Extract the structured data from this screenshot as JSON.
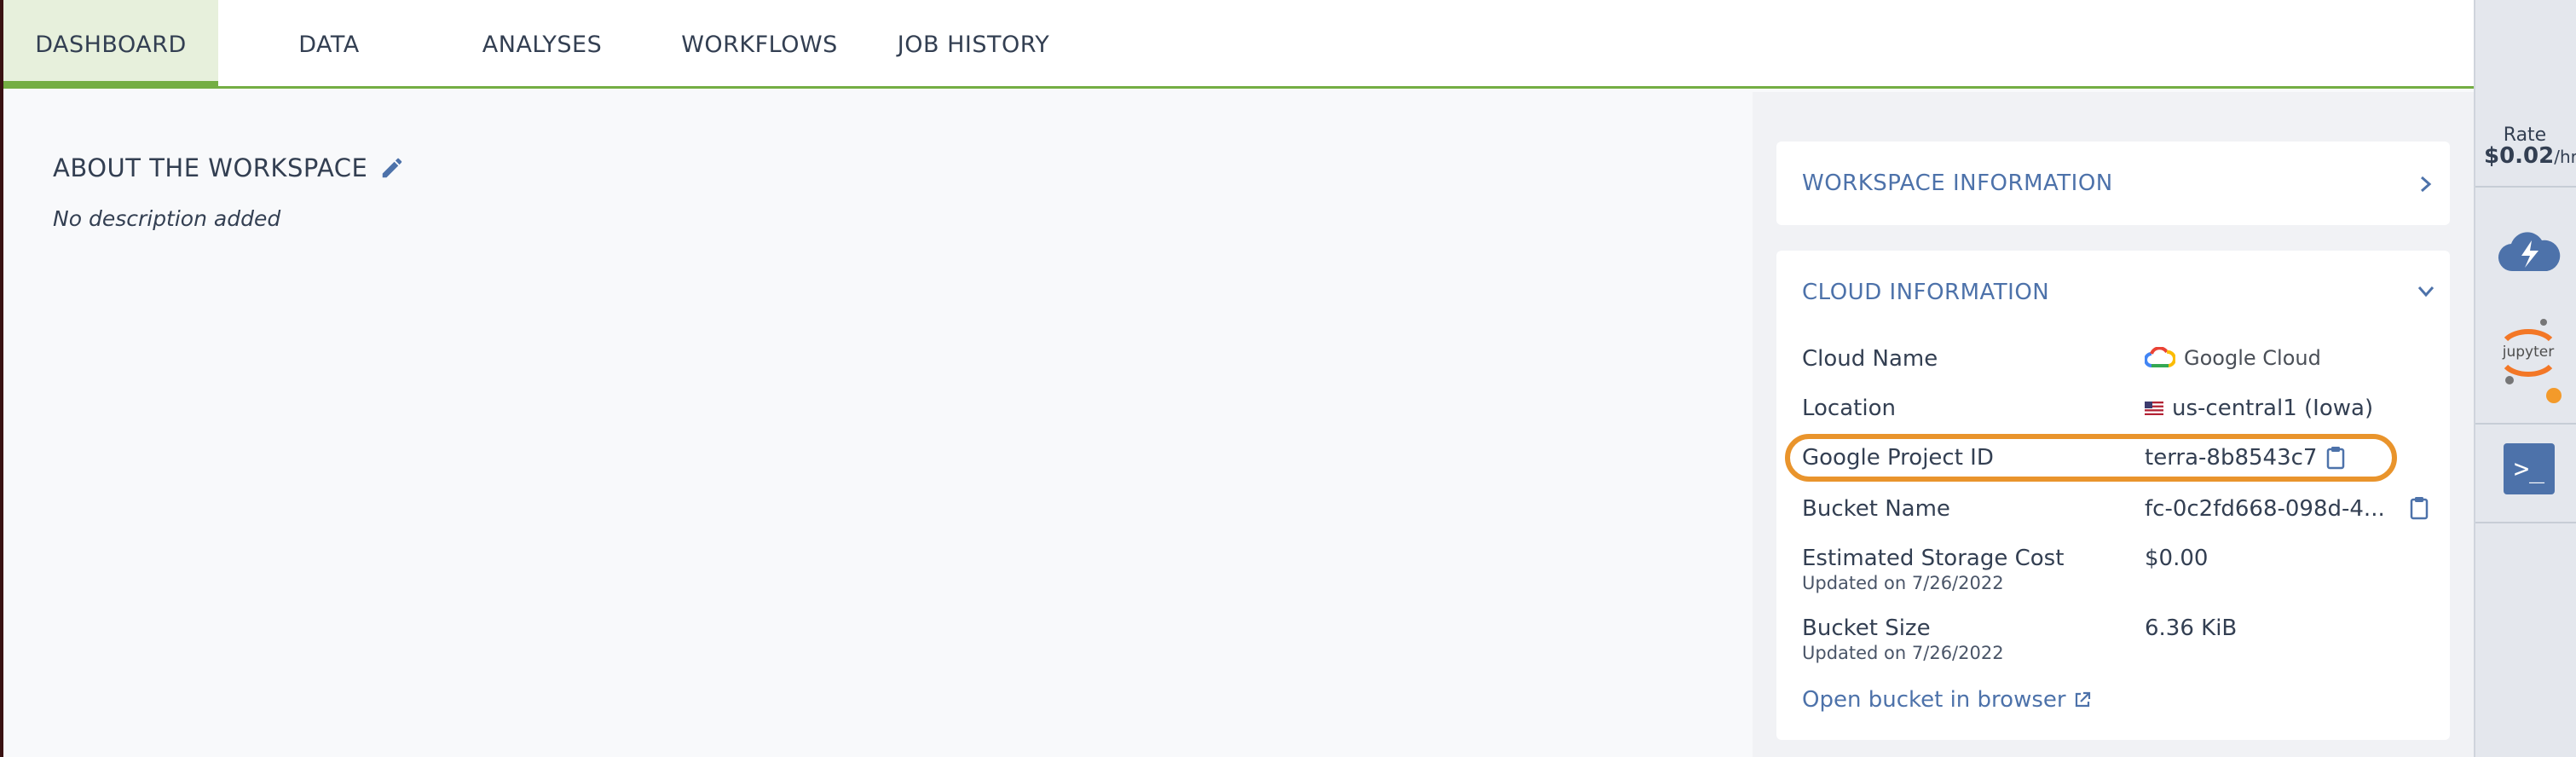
{
  "tabs": [
    {
      "label": "DASHBOARD",
      "active": true
    },
    {
      "label": "DATA"
    },
    {
      "label": "ANALYSES"
    },
    {
      "label": "WORKFLOWS"
    },
    {
      "label": "JOB HISTORY"
    }
  ],
  "about": {
    "title": "ABOUT THE WORKSPACE",
    "description": "No description added"
  },
  "workspace_info": {
    "title": "WORKSPACE INFORMATION"
  },
  "cloud_info": {
    "title": "CLOUD INFORMATION",
    "rows": {
      "cloud_name": {
        "label": "Cloud Name",
        "value": "Google Cloud"
      },
      "location": {
        "label": "Location",
        "value": "us-central1 (Iowa)"
      },
      "project_id": {
        "label": "Google Project ID",
        "value": "terra-8b8543c7"
      },
      "bucket_name": {
        "label": "Bucket Name",
        "value": "fc-0c2fd668-098d-4..."
      },
      "storage_cost": {
        "label": "Estimated Storage Cost",
        "sub": "Updated on 7/26/2022",
        "value": "$0.00"
      },
      "bucket_size": {
        "label": "Bucket Size",
        "sub": "Updated on 7/26/2022",
        "value": "6.36 KiB"
      }
    },
    "open_bucket_link": "Open bucket in browser"
  },
  "sidebar": {
    "rate_label": "Rate",
    "rate_value": "$0.02",
    "rate_unit": "/hr",
    "jupyter_label": "jupyter"
  },
  "colors": {
    "accent_green": "#74ae43",
    "link_blue": "#4d72aa",
    "highlight_orange": "#e9942c",
    "text_dark": "#333f52"
  }
}
